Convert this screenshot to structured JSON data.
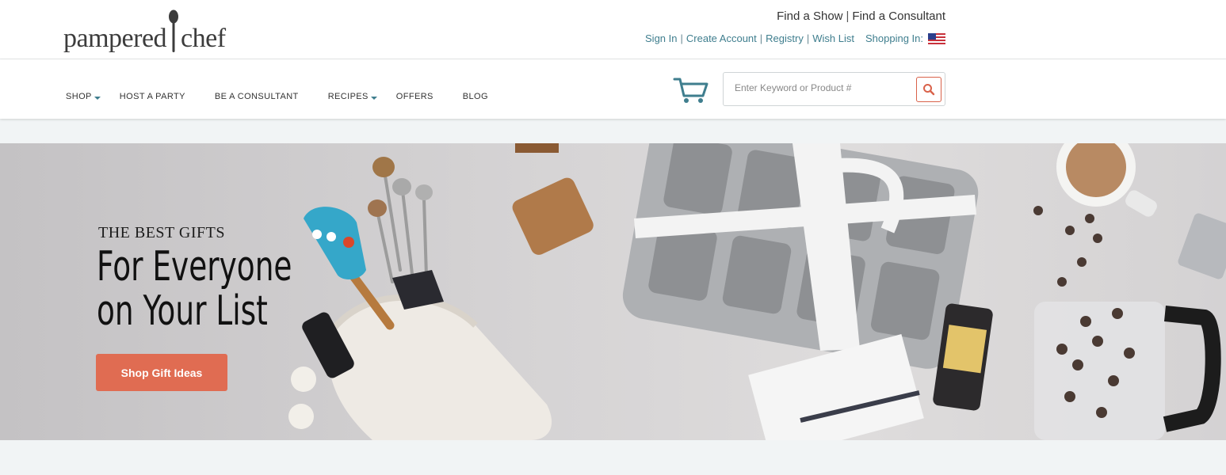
{
  "brand": {
    "logo_left": "pampered",
    "logo_right": "chef"
  },
  "utility": {
    "find_show": "Find a Show",
    "find_consultant": "Find a Consultant",
    "sign_in": "Sign In",
    "create_account": "Create Account",
    "registry": "Registry",
    "wish_list": "Wish List",
    "shopping_in": "Shopping In:",
    "separator": "|",
    "flag_icon": "us-flag-icon"
  },
  "nav": {
    "items": [
      {
        "label": "SHOP",
        "dropdown": true
      },
      {
        "label": "HOST A PARTY",
        "dropdown": false
      },
      {
        "label": "BE A CONSULTANT",
        "dropdown": false
      },
      {
        "label": "RECIPES",
        "dropdown": true
      },
      {
        "label": "OFFERS",
        "dropdown": false
      },
      {
        "label": "BLOG",
        "dropdown": false
      }
    ]
  },
  "search": {
    "placeholder": "Enter Keyword or Product #",
    "value": ""
  },
  "hero": {
    "eyebrow": "THE BEST GIFTS",
    "title_line1": "For Everyone",
    "title_line2": "on Your List",
    "cta": "Shop Gift Ideas"
  },
  "colors": {
    "accent": "#e06c52",
    "link": "#3f7e8e",
    "page_bg": "#f1f4f5"
  }
}
